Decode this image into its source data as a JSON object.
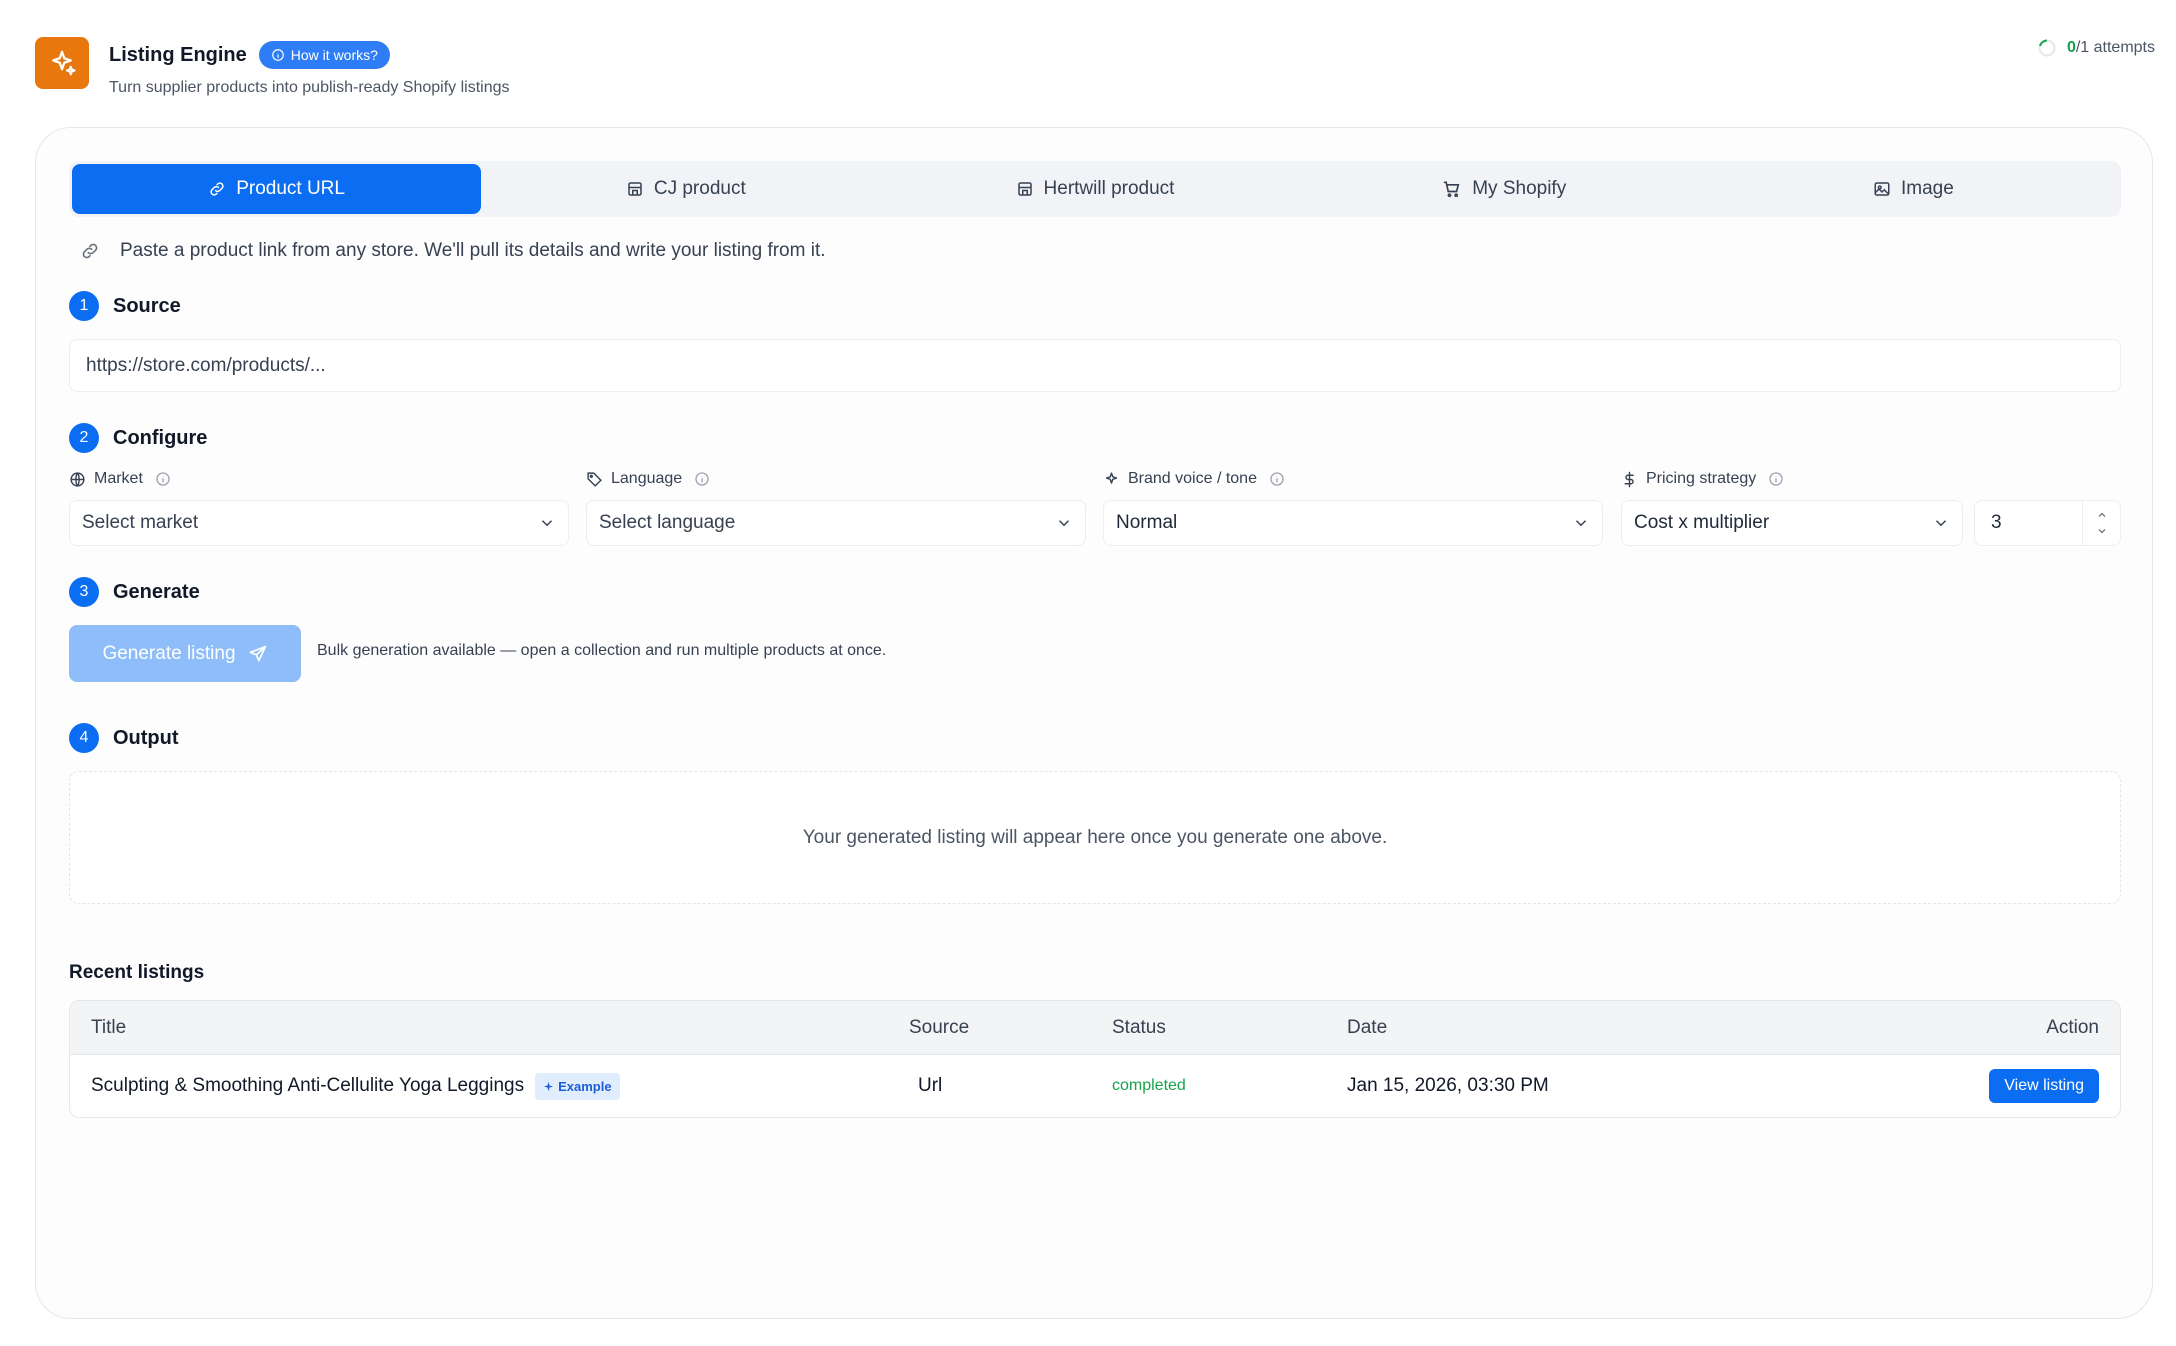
{
  "header": {
    "title": "Listing Engine",
    "how_label": "How it works?",
    "subtitle": "Turn supplier products into publish-ready Shopify listings",
    "attempts_used": "0",
    "attempts_rest": "/1 attempts",
    "accent": "#e8770e"
  },
  "tabs": [
    {
      "label": "Product URL",
      "icon": "link-icon",
      "active": true
    },
    {
      "label": "CJ product",
      "icon": "store-icon",
      "active": false
    },
    {
      "label": "Hertwill product",
      "icon": "store-icon",
      "active": false
    },
    {
      "label": "My Shopify",
      "icon": "cart-icon",
      "active": false
    },
    {
      "label": "Image",
      "icon": "image-icon",
      "active": false
    }
  ],
  "hint": "Paste a product link from any store. We'll pull its details and write your listing from it.",
  "steps": {
    "source": {
      "num": "1",
      "label": "Source"
    },
    "configure": {
      "num": "2",
      "label": "Configure"
    },
    "generate": {
      "num": "3",
      "label": "Generate"
    },
    "output": {
      "num": "4",
      "label": "Output"
    }
  },
  "source_input": {
    "placeholder": "https://store.com/products/..."
  },
  "configure": {
    "market": {
      "label": "Market",
      "value": "Select market"
    },
    "language": {
      "label": "Language",
      "value": "Select language"
    },
    "voice": {
      "label": "Brand voice / tone",
      "value": "Normal"
    },
    "pricing": {
      "label": "Pricing strategy",
      "value": "Cost x multiplier",
      "multiplier": "3"
    }
  },
  "generate": {
    "button_label": "Generate listing",
    "bulk_note": "Bulk generation available — open a collection and run multiple products at once."
  },
  "output": {
    "empty_text": "Your generated listing will appear here once you generate one above."
  },
  "recent": {
    "title": "Recent listings",
    "columns": {
      "title": "Title",
      "source": "Source",
      "status": "Status",
      "date": "Date",
      "action": "Action"
    },
    "rows": [
      {
        "title": "Sculpting & Smoothing Anti-Cellulite Yoga Leggings",
        "badge": "Example",
        "source": "Url",
        "status": "completed",
        "date": "Jan 15, 2026, 03:30 PM",
        "action": "View listing"
      }
    ]
  },
  "colors": {
    "primary": "#0b6df2",
    "success": "#16a34a",
    "disabled_primary": "#8fbdf9"
  }
}
